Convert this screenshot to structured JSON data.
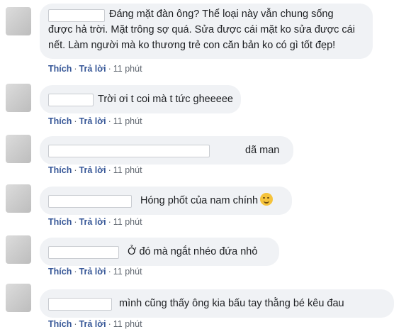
{
  "comments": [
    {
      "text": "Đáng mặt đàn ông? Thể loại này vẫn chung sống\nđược hả trời. Mặt trông sợ quá. Sửa được cái mặt ko sửa được cái\nnết. Làm người mà ko thương trẻ con căn bản ko có gì tốt đẹp!",
      "like": "Thích",
      "reply": "Trả lời",
      "time": "11 phút"
    },
    {
      "text": "Trời ơi t coi mà t tức gheeeee",
      "like": "Thích",
      "reply": "Trả lời",
      "time": "11 phút"
    },
    {
      "text": "dã man",
      "like": "Thích",
      "reply": "Trả lời",
      "time": "11 phút"
    },
    {
      "text": "Hóng phốt của nam chính",
      "emoji": "smiling-face-emoji",
      "like": "Thích",
      "reply": "Trả lời",
      "time": "11 phút"
    },
    {
      "text": "Ở đó mà ngắt nhéo đứa nhỏ",
      "like": "Thích",
      "reply": "Trả lời",
      "time": "11 phút"
    },
    {
      "text": "mình cũng thấy ông kia bấu tay thằng bé kêu đau",
      "like": "Thích",
      "reply": "Trả lời",
      "time": "11 phút"
    }
  ]
}
